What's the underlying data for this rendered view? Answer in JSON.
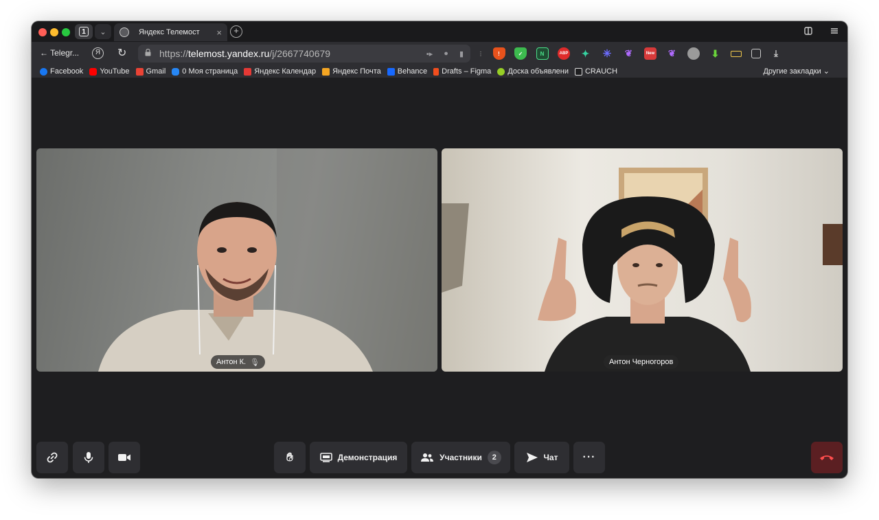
{
  "browser": {
    "tab_count": "1",
    "tab": {
      "title": "Яндекс Телемост",
      "close": "×"
    },
    "back_label": "← Telegr...",
    "url": {
      "scheme": "https://",
      "host": "telemost.yandex.ru",
      "path": "/j/2667740679"
    },
    "bookmarks": [
      {
        "label": "Facebook",
        "color": "#1877f2"
      },
      {
        "label": "YouTube",
        "color": "#ff0000"
      },
      {
        "label": "Gmail",
        "color": "#ea4335"
      },
      {
        "label": "0 Моя страница",
        "color": "#2787f5"
      },
      {
        "label": "Яндекс Календар",
        "color": "#e53935"
      },
      {
        "label": "Яндекс Почта",
        "color": "#f5a623"
      },
      {
        "label": "Behance",
        "color": "#1769ff"
      },
      {
        "label": "Drafts – Figma",
        "color": "#f24e1e"
      },
      {
        "label": "Доска объявлени",
        "color": "#97cf26"
      },
      {
        "label": "CRAUCH",
        "color": "#444444"
      }
    ],
    "other_bookmarks": "Другие закладки ⌄"
  },
  "participants": [
    {
      "name": "Антон К."
    },
    {
      "name": "Антон Черногоров"
    }
  ],
  "toolbar": {
    "demo_label": "Демонстрация",
    "participants_label": "Участники",
    "participants_count": "2",
    "chat_label": "Чат",
    "more_label": "···"
  },
  "colors": {
    "hangup": "#5b1f22",
    "hangup_icon": "#ff4d4d"
  }
}
